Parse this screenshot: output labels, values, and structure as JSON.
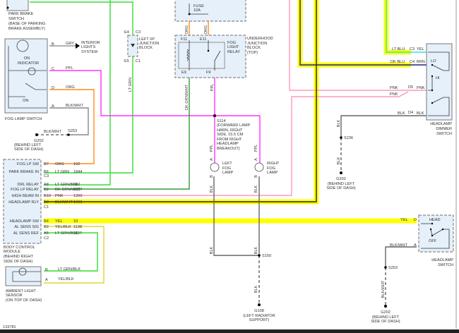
{
  "diagram_id": "133781",
  "colors": {
    "lt_grn": "#33dd33",
    "dk_grn": "#339933",
    "ppl": "#ff33ff",
    "org": "#ff8c1a",
    "pnk": "#ff99bb",
    "yel": "#ffff00",
    "blk": "#555555",
    "dk_blu": "#1a237e",
    "lt_blu": "#33ddee",
    "gry": "#999999"
  },
  "park_brake": {
    "label": "PARK BRAKE",
    "l2": "SWITCH",
    "l3": "(BASE OF PARKING",
    "l4": "BRAKE ASSEMBLY)"
  },
  "fog_switch": {
    "label": "FOG LAMP SWITCH",
    "on_indicator1": "ON",
    "on_indicator2": "INDICATOR",
    "on": "ON",
    "pins": {
      "b": "B",
      "c": "C",
      "d": "D",
      "a": "A"
    },
    "wires": {
      "b": "GRY",
      "c": "PPL",
      "d": "ORG",
      "a": "BLK/WHT"
    }
  },
  "interior_lights": {
    "l1": "INTERIOR",
    "l2": "LIGHTS",
    "l3": "SYSTEM"
  },
  "g202_left": {
    "wire": "BLK/WHT",
    "splice": "S253",
    "ground": "G202",
    "l1": "(BEHIND LEFT",
    "l2": "SIDE OF DASH)"
  },
  "ip_junction": {
    "e4": "E4",
    "c3": "C3",
    "e5": "E5",
    "c1": "C1",
    "l1": "LEFT I/P",
    "l2": "JUNCTION",
    "l3": "BLOCK",
    "wire": "LT GRN"
  },
  "bcm": {
    "rows": [
      {
        "label": "FOG LP SW",
        "pin": "B7",
        "wire": "ORG",
        "circuit": "192"
      },
      {
        "label": "PARK BRAKE IN",
        "pin": "B6",
        "wire": "LT GRN",
        "circuit": "1844"
      },
      {
        "label": "",
        "pin": "C3",
        "wire": "",
        "circuit": ""
      },
      {
        "label": "DRL RELAY",
        "pin": "A8",
        "wire": "LT GRN/BLK",
        "circuit": "592"
      },
      {
        "label": "FOG LP RELAY",
        "pin": "B2",
        "wire": "DK GRN/WHT",
        "circuit": "1317"
      },
      {
        "label": "HIGH BEAM IN",
        "pin": "B10",
        "wire": "PNK",
        "circuit": "1200"
      },
      {
        "label": "HEADLAMP RLY",
        "pin": "B3",
        "wire": "BLK/WHT",
        "circuit": "1969"
      },
      {
        "label": "",
        "pin": "C1",
        "wire": "",
        "circuit": ""
      },
      {
        "label": "HEADLAMP SW",
        "pin": "B4",
        "wire": "YEL",
        "circuit": "10"
      },
      {
        "label": "AL SENS SIG",
        "pin": "B2",
        "wire": "YEL/BLK",
        "circuit": "1138"
      },
      {
        "label": "AL SENS REF",
        "pin": "A5",
        "wire": "LT GRN/BLK",
        "circuit": "1137"
      },
      {
        "label": "",
        "pin": "C2",
        "wire": "",
        "circuit": ""
      }
    ],
    "l1": "BODY CONTROL",
    "l2": "MODULE",
    "l3": "(BEHIND RIGHT",
    "l4": "SIDE OF DASH)"
  },
  "ambient": {
    "pin_b": "B",
    "pin_a": "A",
    "wire_b": "LT GRN/BLK",
    "wire_a": "YEL/BLK",
    "l1": "AMBIENT LIGHT",
    "l2": "SENSOR",
    "l3": "(ON TOP OF DASH)"
  },
  "fuse": {
    "l1": "FUSE",
    "l2": "10A",
    "wire1": "ORG",
    "wire2": "ORG"
  },
  "underhood": {
    "l1": "UNDERHOOD",
    "l2": "JUNCTION",
    "l3": "BLOCK",
    "l4": "(TOP)",
    "f11": "F11",
    "e11": "E11",
    "e9": "E9",
    "f9": "F9",
    "relay1": "FOG",
    "relay2": "LIGHT",
    "relay3": "RELAY",
    "wire_e9": "DK GRN/WHT",
    "wire_f9": "PPL"
  },
  "s114": {
    "l1": "S114",
    "l2": "(FORWARD LAMP",
    "l3": "HARN, RIGHT",
    "l4": "SIDE, 15.5 CM",
    "l5": "FROM RIGHT",
    "l6": "HEADLAMP",
    "l7": "BREAKOUT)"
  },
  "left_fog": {
    "l1": "LEFT",
    "l2": "FOG",
    "l3": "LAMP",
    "pin_a": "A",
    "pin_b": "B",
    "wire_a": "PPL",
    "wire_b": "BLK",
    "wire_c": "BLK"
  },
  "right_fog": {
    "l1": "RIGHT",
    "l2": "FOG",
    "l3": "LAMP",
    "pin_a": "A",
    "pin_b": "B",
    "wire_a": "PPL",
    "wire_b": "BLK",
    "wire_c": "BLK"
  },
  "g108": {
    "splice": "S150",
    "wire": "BLK",
    "ground": "G108",
    "l1": "(LEFT RADIATOR",
    "l2": "SUPPORT)"
  },
  "dimmer": {
    "c3": "C3",
    "c4": "C4",
    "d5": "D5",
    "d4": "D4",
    "lt_blu": "LT BLU",
    "yel": "YEL",
    "dk_blu": "DK BLU",
    "brn": "BRN",
    "pnk1": "PNK",
    "pnk2": "PNK",
    "pnk3": "PNK",
    "blk1": "BLK",
    "blk2": "BLK",
    "lo": "LO",
    "hi": "HI",
    "l1": "HEADLAMP",
    "l2": "DIMMER",
    "l3": "SWITCH"
  },
  "g202_mid": {
    "wire1": "BLK",
    "splice": "S236",
    "wire2": "BLK",
    "ground": "G202",
    "l1": "(BEHIND LEFT",
    "l2": "SIDE OF DASH)"
  },
  "headlamp_sw": {
    "pin_d": "D",
    "pin_a": "A",
    "wire_d": "YEL",
    "wire_a": "BLK/WHT",
    "head": "HEAD",
    "off": "OFF",
    "l1": "HEADLAMP",
    "l2": "SWITCH"
  },
  "g202_right": {
    "splice": "S253",
    "wire": "BLK/WHT",
    "ground": "G202",
    "l1": "(BEHIND LEFT",
    "l2": "SIDE OF DASH)"
  }
}
